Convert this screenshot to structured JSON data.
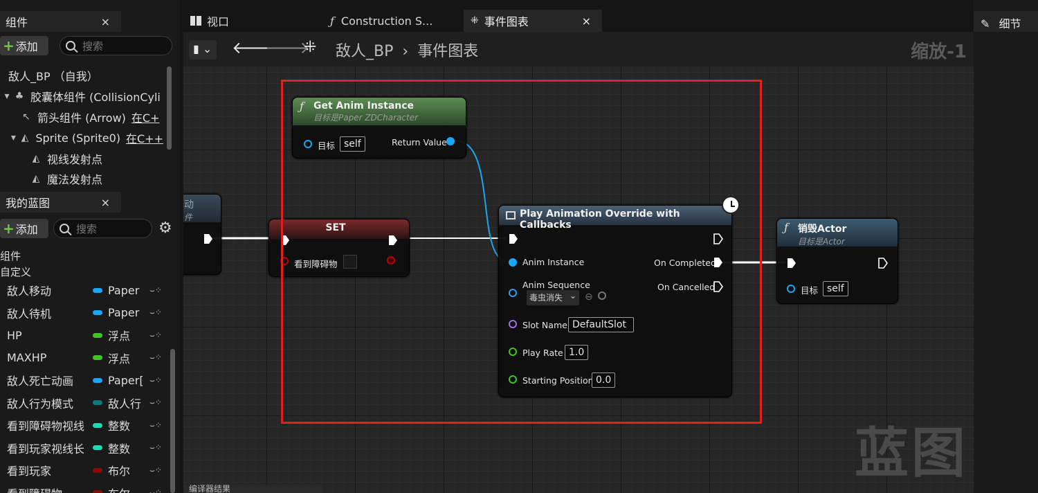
{
  "components_panel": {
    "title": "组件",
    "add_label": "添加",
    "search_placeholder": "搜索",
    "tree": [
      {
        "label": "敌人_BP （自我）",
        "extra": ""
      },
      {
        "label": "胶囊体组件 (CollisionCyli",
        "extra": ""
      },
      {
        "label": "箭头组件 (Arrow)",
        "extra": "在C+"
      },
      {
        "label": "Sprite (Sprite0)",
        "extra": "在C++"
      },
      {
        "label": "视线发射点",
        "extra": ""
      },
      {
        "label": "魔法发射点",
        "extra": ""
      }
    ]
  },
  "blueprint_panel": {
    "title": "我的蓝图",
    "add_label": "添加",
    "search_placeholder": "搜索",
    "sections": [
      "组件",
      "自定义"
    ],
    "variables": [
      {
        "name": "敌人移动",
        "type": "Paper",
        "color": "#1aa6f0"
      },
      {
        "name": "敌人待机",
        "type": "Paper",
        "color": "#1aa6f0"
      },
      {
        "name": "HP",
        "type": "浮点",
        "color": "#3ec620"
      },
      {
        "name": "MAXHP",
        "type": "浮点",
        "color": "#3ec620"
      },
      {
        "name": "敌人死亡动画",
        "type": "Paper[",
        "color": "#1aa6f0"
      },
      {
        "name": "敌人行为模式",
        "type": "敌人行",
        "color": "#0a7a7a"
      },
      {
        "name": "看到障碍物视线",
        "type": "整数",
        "color": "#20d8b0"
      },
      {
        "name": "看到玩家视线长",
        "type": "整数",
        "color": "#20d8b0"
      },
      {
        "name": "看到玩家",
        "type": "布尔",
        "color": "#8a0a0a"
      },
      {
        "name": "看到障碍物",
        "type": "布尔",
        "color": "#8a0a0a"
      }
    ]
  },
  "doc_tabs": [
    {
      "label": "视口"
    },
    {
      "label": "Construction S..."
    },
    {
      "label": "事件图表",
      "close": "×"
    }
  ],
  "breadcrumb": {
    "root": "敌人_BP",
    "sep": "›",
    "current": "事件图表"
  },
  "zoom_label": "缩放-1",
  "watermark": "蓝图",
  "right_panel": {
    "title": "细节"
  },
  "bottom_tab": "编译器结果",
  "left_node": {
    "title": "动",
    "subtitle": "件"
  },
  "nodes": {
    "get_anim": {
      "title": "Get Anim Instance",
      "subtitle": "目标是Paper ZDCharacter",
      "target_label": "目标",
      "target_value": "self",
      "return_label": "Return Value"
    },
    "set": {
      "title": "SET",
      "var_label": "看到障碍物"
    },
    "play": {
      "title": "Play Animation Override with Callbacks",
      "anim_instance": "Anim Instance",
      "on_completed": "On Completed",
      "on_cancelled": "On Cancelled",
      "anim_sequence": "Anim Sequence",
      "sequence_value": "毒虫消失",
      "slot_name_label": "Slot Name",
      "slot_name_value": "DefaultSlot",
      "play_rate_label": "Play Rate",
      "play_rate_value": "1.0",
      "start_pos_label": "Starting Position",
      "start_pos_value": "0.0"
    },
    "destroy": {
      "title": "销毁Actor",
      "subtitle": "目标是Actor",
      "target_label": "目标",
      "target_value": "self"
    }
  },
  "colors": {
    "object_pin": "#1aa6f0",
    "float_pin": "#3ec620",
    "name_pin": "#a070e0",
    "bool_pin": "#8a0a0a",
    "highlight": "#e02020"
  }
}
